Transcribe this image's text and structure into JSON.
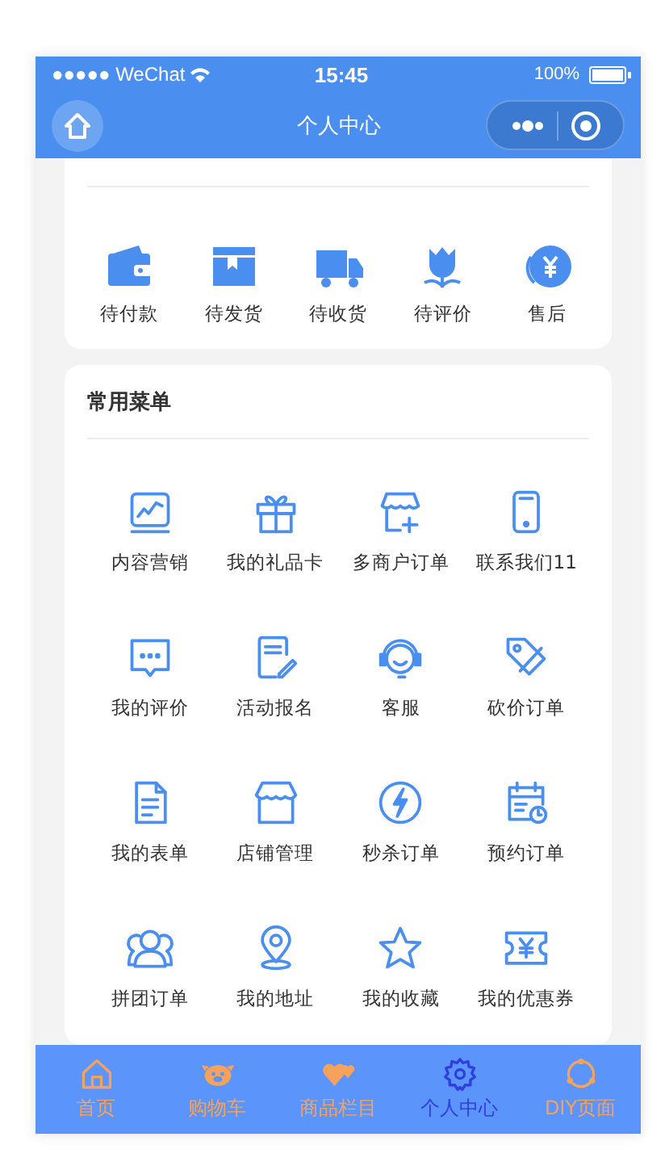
{
  "status_bar": {
    "carrier": "●●●●● WeChat",
    "time": "15:45",
    "battery": "100%"
  },
  "nav_bar": {
    "title": "个人中心"
  },
  "orders": {
    "items": [
      {
        "label": "待付款"
      },
      {
        "label": "待发货"
      },
      {
        "label": "待收货"
      },
      {
        "label": "待评价"
      },
      {
        "label": "售后"
      }
    ]
  },
  "menu": {
    "title": "常用菜单",
    "items": [
      {
        "label": "内容营销"
      },
      {
        "label": "我的礼品卡"
      },
      {
        "label": "多商户订单"
      },
      {
        "label": "联系我们11"
      },
      {
        "label": "我的评价"
      },
      {
        "label": "活动报名"
      },
      {
        "label": "客服"
      },
      {
        "label": "砍价订单"
      },
      {
        "label": "我的表单"
      },
      {
        "label": "店铺管理"
      },
      {
        "label": "秒杀订单"
      },
      {
        "label": "预约订单"
      },
      {
        "label": "拼团订单"
      },
      {
        "label": "我的地址"
      },
      {
        "label": "我的收藏"
      },
      {
        "label": "我的优惠券"
      }
    ]
  },
  "tab_bar": [
    {
      "label": "首页",
      "selected": false
    },
    {
      "label": "购物车",
      "selected": false
    },
    {
      "label": "商品栏目",
      "selected": false
    },
    {
      "label": "个人中心",
      "selected": true
    },
    {
      "label": "DIY页面",
      "selected": false
    }
  ]
}
